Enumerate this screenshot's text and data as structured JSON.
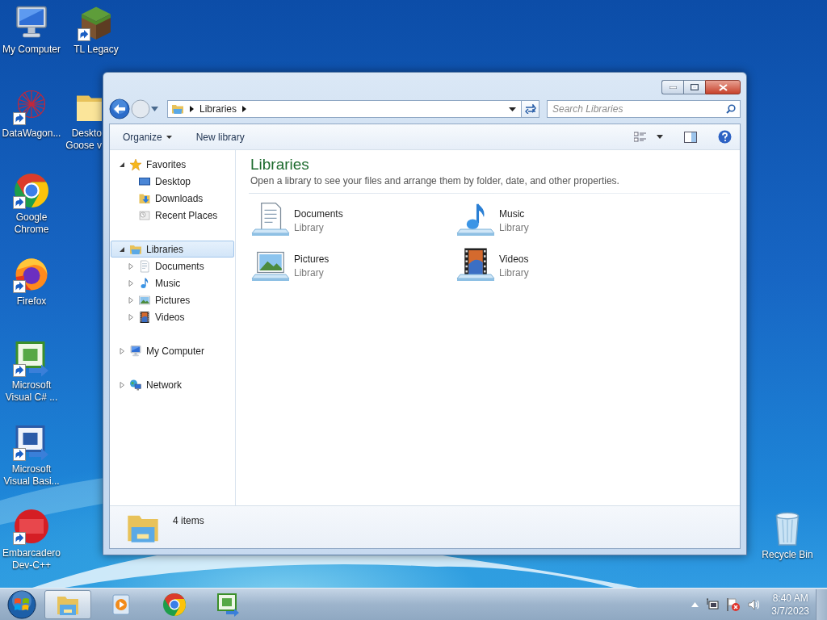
{
  "desktop_icons": [
    {
      "kind": "computer",
      "label_lines": [
        "My Computer"
      ],
      "shortcut": false,
      "cut": false
    },
    {
      "kind": "graph",
      "label_lines": [
        "DataWagon..."
      ],
      "shortcut": true,
      "cut": false
    },
    {
      "kind": "browser",
      "label_lines": [
        "Google",
        "Chrome"
      ],
      "shortcut": true,
      "cut": false
    },
    {
      "kind": "fox",
      "label_lines": [
        "Firefox"
      ],
      "shortcut": true,
      "cut": false
    },
    {
      "kind": "csharp",
      "label_lines": [
        "Microsoft",
        "Visual C# ..."
      ],
      "shortcut": true,
      "cut": false
    },
    {
      "kind": "vb",
      "label_lines": [
        "Microsoft",
        "Visual Basi..."
      ],
      "shortcut": true,
      "cut": false
    },
    {
      "kind": "dev",
      "label_lines": [
        "Embarcadero",
        "Dev-C++"
      ],
      "shortcut": true,
      "cut": false
    },
    {
      "kind": "grass",
      "label_lines": [
        "TL Legacy"
      ],
      "shortcut": true,
      "cut": false
    },
    {
      "kind": "folder",
      "label_lines": [
        "Deskto",
        "Goose v"
      ],
      "shortcut": false,
      "cut": true
    }
  ],
  "recycle_bin": {
    "kind": "bin",
    "label_lines": [
      "Recycle Bin"
    ]
  },
  "window": {
    "address": {
      "crumbs": [
        "Libraries"
      ]
    },
    "search": {
      "placeholder": "Search Libraries"
    },
    "toolbar": [
      {
        "label": "Organize",
        "dropdown": true
      },
      {
        "label": "New library",
        "dropdown": false
      }
    ],
    "nav": [
      {
        "label": "Favorites",
        "kind": "star",
        "expanded": true,
        "selected": false,
        "children": [
          {
            "label": "Desktop",
            "kind": "desktop",
            "selected": false
          },
          {
            "label": "Downloads",
            "kind": "downloads",
            "selected": false
          },
          {
            "label": "Recent Places",
            "kind": "recent",
            "selected": false
          }
        ]
      },
      {
        "label": "Libraries",
        "kind": "libraries",
        "expanded": true,
        "selected": true,
        "children": [
          {
            "label": "Documents",
            "kind": "documents",
            "expanded": false,
            "selected": false
          },
          {
            "label": "Music",
            "kind": "music",
            "expanded": false,
            "selected": false
          },
          {
            "label": "Pictures",
            "kind": "pictures",
            "expanded": false,
            "selected": false
          },
          {
            "label": "Videos",
            "kind": "videos",
            "expanded": false,
            "selected": false
          }
        ]
      },
      {
        "label": "My Computer",
        "kind": "computer",
        "expanded": false,
        "selected": false
      },
      {
        "label": "Network",
        "kind": "network",
        "expanded": false,
        "selected": false
      }
    ],
    "content": {
      "title": "Libraries",
      "subtitle": "Open a library to see your files and arrange them by folder, date, and other properties.",
      "items": [
        {
          "name": "Documents",
          "type": "Library",
          "kind": "documents"
        },
        {
          "name": "Music",
          "type": "Library",
          "kind": "music"
        },
        {
          "name": "Pictures",
          "type": "Library",
          "kind": "pictures"
        },
        {
          "name": "Videos",
          "type": "Library",
          "kind": "videos"
        }
      ]
    },
    "status": {
      "text": "4 items"
    }
  },
  "taskbar": {
    "items": [
      {
        "kind": "explorer",
        "selected": true
      },
      {
        "kind": "player",
        "selected": false
      },
      {
        "kind": "browser",
        "selected": false
      },
      {
        "kind": "csharp",
        "selected": false
      }
    ],
    "clock": {
      "time": "8:40 AM",
      "date": "3/7/2023"
    }
  }
}
